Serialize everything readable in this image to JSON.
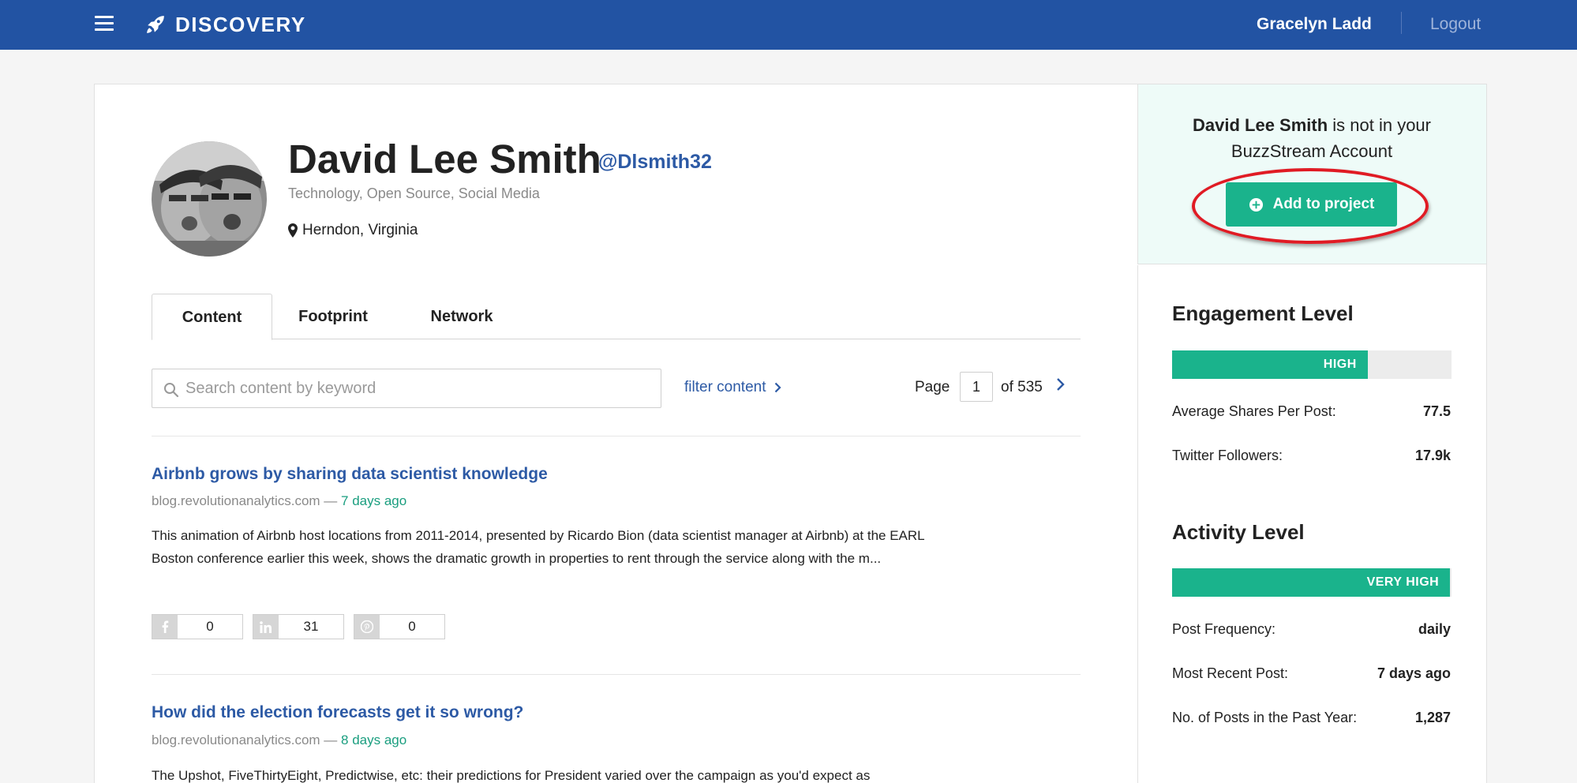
{
  "nav": {
    "brand": "DISCOVERY",
    "user_name": "Gracelyn Ladd",
    "logout": "Logout"
  },
  "profile": {
    "name": "David Lee Smith",
    "handle": "@Dlsmith32",
    "topics": "Technology, Open Source, Social Media",
    "location": "Herndon, Virginia"
  },
  "tabs": [
    {
      "label": "Content",
      "active": true
    },
    {
      "label": "Footprint",
      "active": false
    },
    {
      "label": "Network",
      "active": false
    }
  ],
  "search": {
    "placeholder": "Search content by keyword",
    "value": ""
  },
  "filter": {
    "label": "filter content"
  },
  "pagination": {
    "label": "Page",
    "current": "1",
    "of_label": "of 535"
  },
  "content_items": [
    {
      "title": "Airbnb grows by sharing data scientist knowledge",
      "domain": "blog.revolutionanalytics.com",
      "separator": " — ",
      "ago": "7 days ago",
      "description": "This animation of Airbnb host locations from 2011-2014, presented by Ricardo Bion (data scientist manager at Airbnb) at the EARL Boston conference earlier this week, shows the dramatic growth in properties to rent through the service along with the m...",
      "shares": [
        {
          "network": "facebook",
          "icon": "facebook-icon",
          "count": "0"
        },
        {
          "network": "linkedin",
          "icon": "linkedin-icon",
          "count": "31"
        },
        {
          "network": "pinterest",
          "icon": "pinterest-icon",
          "count": "0"
        }
      ]
    },
    {
      "title": "How did the election forecasts get it so wrong?",
      "domain": "blog.revolutionanalytics.com",
      "separator": " — ",
      "ago": "8 days ago",
      "description": "The Upshot, FiveThirtyEight, Predictwise, etc: their predictions for President varied over the campaign as you'd expect as"
    }
  ],
  "sidebar": {
    "account_name": "David Lee Smith",
    "account_msg": " is not in your BuzzStream Account",
    "add_button": "Add to project",
    "engagement": {
      "title": "Engagement Level",
      "level": "HIGH",
      "fill_fraction": 0.7,
      "stats": [
        {
          "label": "Average Shares Per Post:",
          "value": "77.5"
        },
        {
          "label": "Twitter Followers:",
          "value": "17.9k"
        }
      ]
    },
    "activity": {
      "title": "Activity Level",
      "level": "VERY HIGH",
      "fill_fraction": 0.995,
      "stats": [
        {
          "label": "Post Frequency:",
          "value": "daily"
        },
        {
          "label": "Most Recent Post:",
          "value": "7 days ago"
        },
        {
          "label": "No. of Posts in the Past Year:",
          "value": "1,287"
        }
      ]
    }
  },
  "colors": {
    "nav_bg": "#2253a3",
    "accent_green": "#1ab38c",
    "link_blue": "#2d5aa5",
    "highlight_red": "#e01b24"
  }
}
